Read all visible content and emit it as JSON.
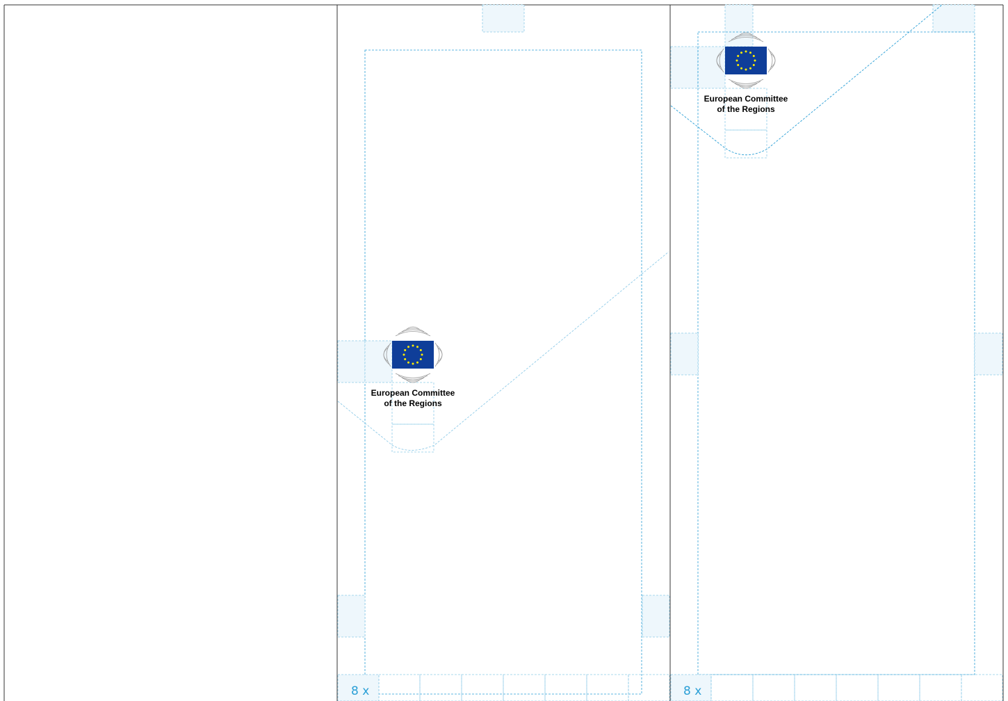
{
  "logos": [
    {
      "line1": "European Committee",
      "line2": "of the Regions"
    },
    {
      "line1": "European Committee",
      "line2": "of the Regions"
    }
  ],
  "unit_labels": [
    "8 x",
    "8 x"
  ],
  "colors": {
    "panel_border": "#333333",
    "guide": "#2a9fd6",
    "guide_light": "#8fcbe8",
    "unit_fill": "#eef7fc",
    "flag_blue": "#0f3e99",
    "star_yellow": "#ffed00",
    "swirl_grey": "#9a9a9a",
    "text": "#000000"
  }
}
